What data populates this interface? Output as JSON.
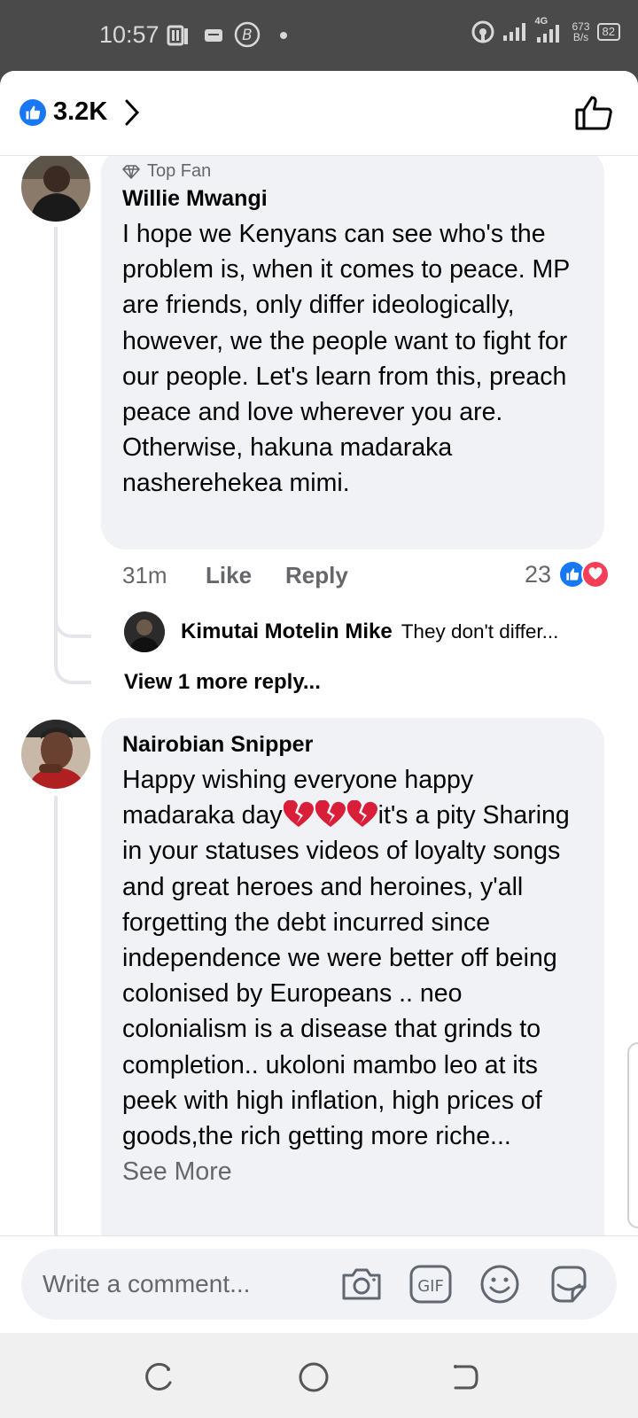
{
  "status_bar": {
    "time": "10:57",
    "network": "4G",
    "speed_value": "673",
    "speed_unit": "B/s",
    "battery": "82"
  },
  "header": {
    "reaction_count": "3.2K"
  },
  "comments": [
    {
      "badge": "Top Fan",
      "author": "Willie Mwangi",
      "text": "I hope we Kenyans can see who's the problem is, when it comes to peace. MP are friends, only differ ideologically, however, we the people want to fight for our people. Let's learn from this, preach peace and love wherever you are. Otherwise, hakuna madaraka nasherehekea mimi.",
      "time": "31m",
      "like_label": "Like",
      "reply_label": "Reply",
      "reaction_count": "23",
      "reply_preview": {
        "author": "Kimutai Motelin Mike",
        "text": "They don't differ..."
      },
      "view_more": "View 1 more reply..."
    },
    {
      "author": "Nairobian Snipper",
      "text_before": "Happy wishing everyone happy madaraka day",
      "text_after": "it's a pity Sharing in your statuses videos of loyalty songs and great heroes and heroines, y'all forgetting the debt incurred since independence we were better off being colonised by Europeans .. neo colonialism is a disease that grinds to completion.. ukoloni mambo leo at its peek with high inflation, high prices of goods,the rich getting more riche...",
      "see_more": "See More"
    }
  ],
  "composer": {
    "placeholder": "Write a comment..."
  },
  "icons": {
    "like": "thumbs-up-icon",
    "camera": "camera-icon",
    "gif": "gif-icon",
    "emoji": "smiley-icon",
    "sticker": "sticker-icon"
  },
  "colors": {
    "facebook_blue": "#1877f2",
    "love_red": "#f33e58",
    "bubble_bg": "#f0f2f5",
    "secondary_text": "#65676b"
  }
}
